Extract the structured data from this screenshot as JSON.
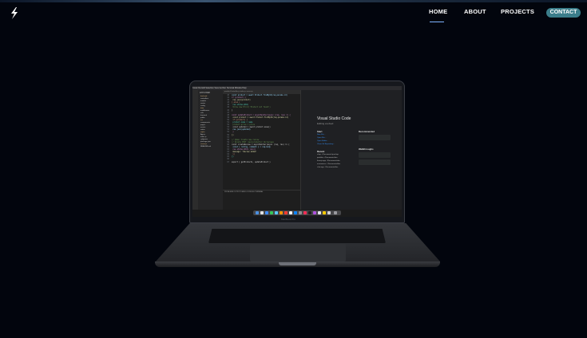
{
  "nav": {
    "logo_icon": "lightning-bolt-icon",
    "links": [
      "HOME",
      "ABOUT",
      "PROJECTS"
    ],
    "contact": "CONTACT",
    "active": "HOME"
  },
  "screen": {
    "menubar": "  Code   File   Edit   Selection   View   Go   Run   Terminal   Window   Help",
    "explorer_title": "EXPLORER",
    "explorer_rows": [
      "backend",
      "controllers",
      "models",
      "routes",
      "config",
      "data",
      "middleware",
      "utils",
      "frontend",
      "public",
      "src",
      "components",
      "pages",
      "assets",
      "redux",
      "styles",
      "App.js",
      "index.js",
      ".gitignore",
      "package.json",
      "server.js",
      "README.md"
    ],
    "tabs": "productController.js    index.js    server.js",
    "code_lines": [
      "const product = await Product.findById(req.params.id)",
      "if (product) {",
      "  res.json(product)",
      "} else {",
      "  res.status(404)",
      "  throw new Error('Product not found')",
      "}",
      "",
      "const updateProduct = asyncHandler(async (req, res) => {",
      "  const product = await Product.findById(req.params.id)",
      "  if (product) {",
      "    product.name = name",
      "    product.price = price",
      "    const updated = await product.save()",
      "    res.json(updated)",
      "  }",
      "})",
      "",
      "// @desc   Create new review",
      "// @route  POST /api/products/:id/reviews",
      "const createReview = asyncHandler(async (req, res) => {",
      "  const { rating, comment } = req.body",
      "  res.status(201).json({",
      "    message: 'Review added'",
      "  })",
      "})",
      "",
      "export { getProducts, updateProduct }"
    ],
    "terminal_tabs": "PROBLEMS   OUTPUT   DEBUG CONSOLE   TERMINAL",
    "welcome": {
      "title": "Visual Studio Code",
      "subtitle": "Editing evolved",
      "start": "Start",
      "start_links": [
        "New File...",
        "Open File...",
        "Open Folder...",
        "Clone Git Repository..."
      ],
      "recent": "Recent",
      "recent_items": [
        "shop   ~/Documents/proshop",
        "portfolio   ~/Documents/dev",
        "threejs-app   ~/Documents/dev",
        "ecommerce   ~/Documents/dev",
        "chat-app   ~/Documents/dev"
      ],
      "recommended": "Recommended",
      "walkthroughs": "Walkthroughs"
    },
    "hinge_label": "MacBook Pro"
  },
  "colors": {
    "background": "#02050d",
    "contact_bg": "#3b7d8a",
    "underline": "#7fb3ff"
  }
}
